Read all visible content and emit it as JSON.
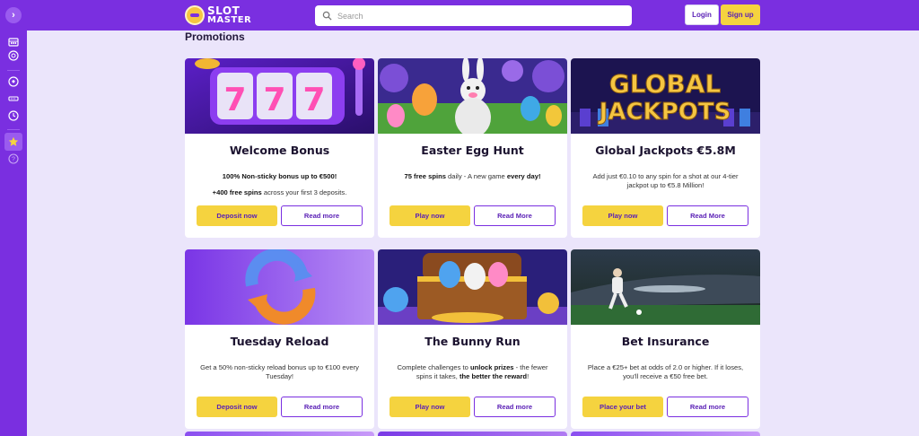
{
  "header": {
    "logo_line1": "SLOT",
    "logo_line2": "MASTER",
    "search_placeholder": "Search",
    "login_label": "Login",
    "signup_label": "Sign up"
  },
  "sidebar": {
    "items": [
      {
        "icon": "expand-icon"
      },
      {
        "icon": "slot-machine-icon"
      },
      {
        "icon": "casino-chip-icon"
      },
      {
        "icon": "football-icon"
      },
      {
        "icon": "ticket-icon"
      },
      {
        "icon": "history-icon"
      },
      {
        "icon": "star-icon",
        "active": true
      },
      {
        "icon": "help-icon"
      }
    ]
  },
  "page": {
    "title": "Promotions"
  },
  "promotions": [
    {
      "title": "Welcome Bonus",
      "desc_parts": [
        {
          "b": "100% Non-sticky bonus up to €500!"
        },
        {
          "br": true
        },
        {
          "b": "+400 free spins"
        },
        {
          "t": " across your first 3 deposits."
        }
      ],
      "primary": "Deposit now",
      "secondary": "Read more",
      "image_theme": "slot-reels-777"
    },
    {
      "title": "Easter Egg Hunt",
      "desc_parts": [
        {
          "b": "75 free spins"
        },
        {
          "t": " daily - A new game "
        },
        {
          "b": "every day!"
        }
      ],
      "primary": "Play now",
      "secondary": "Read More",
      "image_theme": "easter-bunny"
    },
    {
      "title": "Global Jackpots €5.8M",
      "desc_parts": [
        {
          "t": "Add just €0.10 to any spin for a shot at our 4-tier jackpot up to €5.8 Million!"
        }
      ],
      "primary": "Play now",
      "secondary": "Read More",
      "image_theme": "global-jackpots",
      "image_text_1": "GLOBAL",
      "image_text_2": "JACKPOTS"
    },
    {
      "title": "Tuesday Reload",
      "desc_parts": [
        {
          "t": "Get a 50% non-sticky reload bonus up to €100 every Tuesday!"
        }
      ],
      "primary": "Deposit now",
      "secondary": "Read more",
      "image_theme": "reload-arrows"
    },
    {
      "title": "The Bunny Run",
      "desc_parts": [
        {
          "t": "Complete challenges to "
        },
        {
          "b": "unlock prizes"
        },
        {
          "t": " - the fewer spins it takes, "
        },
        {
          "b": "the better the reward"
        },
        {
          "t": "!"
        }
      ],
      "primary": "Play now",
      "secondary": "Read more",
      "image_theme": "treasure-chest-eggs"
    },
    {
      "title": "Bet Insurance",
      "desc_parts": [
        {
          "t": "Place a €25+ bet at odds of 2.0 or higher. If it loses, you'll receive a €50 free bet."
        }
      ],
      "primary": "Place your bet",
      "secondary": "Read more",
      "image_theme": "football-stadium"
    }
  ],
  "colors": {
    "brand_purple": "#7a2fe0",
    "accent_yellow": "#f5d33f",
    "page_bg": "#ebe5fb"
  }
}
